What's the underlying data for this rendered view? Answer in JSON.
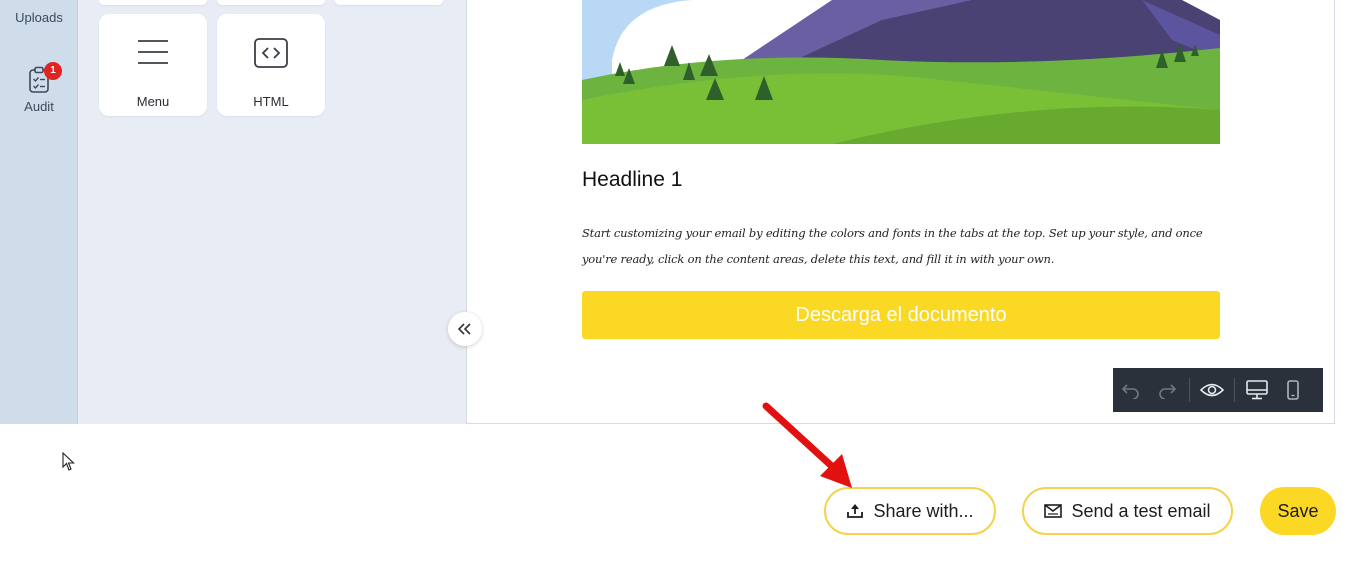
{
  "rail": {
    "uploads_label": "Uploads",
    "audit_label": "Audit",
    "audit_badge": "1"
  },
  "blocks": {
    "menu_label": "Menu",
    "html_label": "HTML"
  },
  "email": {
    "headline": "Headline 1",
    "body": "Start customizing your email by editing the colors and fonts in the tabs at the top. Set up your style, and once you're ready, click on the content areas, delete this text, and fill it in with your own.",
    "cta_label": "Descarga el documento"
  },
  "footer": {
    "share_label": "Share with...",
    "test_email_label": "Send a test email",
    "save_label": "Save"
  },
  "colors": {
    "accent": "#fbd824",
    "rail_bg": "#cfdcea",
    "panel_bg": "#e8edf5",
    "toolbar_bg": "#2a313b",
    "badge": "#e02424",
    "annotation_arrow": "#e31010"
  },
  "icons": [
    "upload-cloud-icon",
    "clipboard-check-icon",
    "hamburger-menu-icon",
    "code-brackets-icon",
    "double-chevron-left-icon",
    "undo-icon",
    "redo-icon",
    "eye-icon",
    "desktop-icon",
    "mobile-icon",
    "share-upload-icon",
    "envelope-icon"
  ]
}
